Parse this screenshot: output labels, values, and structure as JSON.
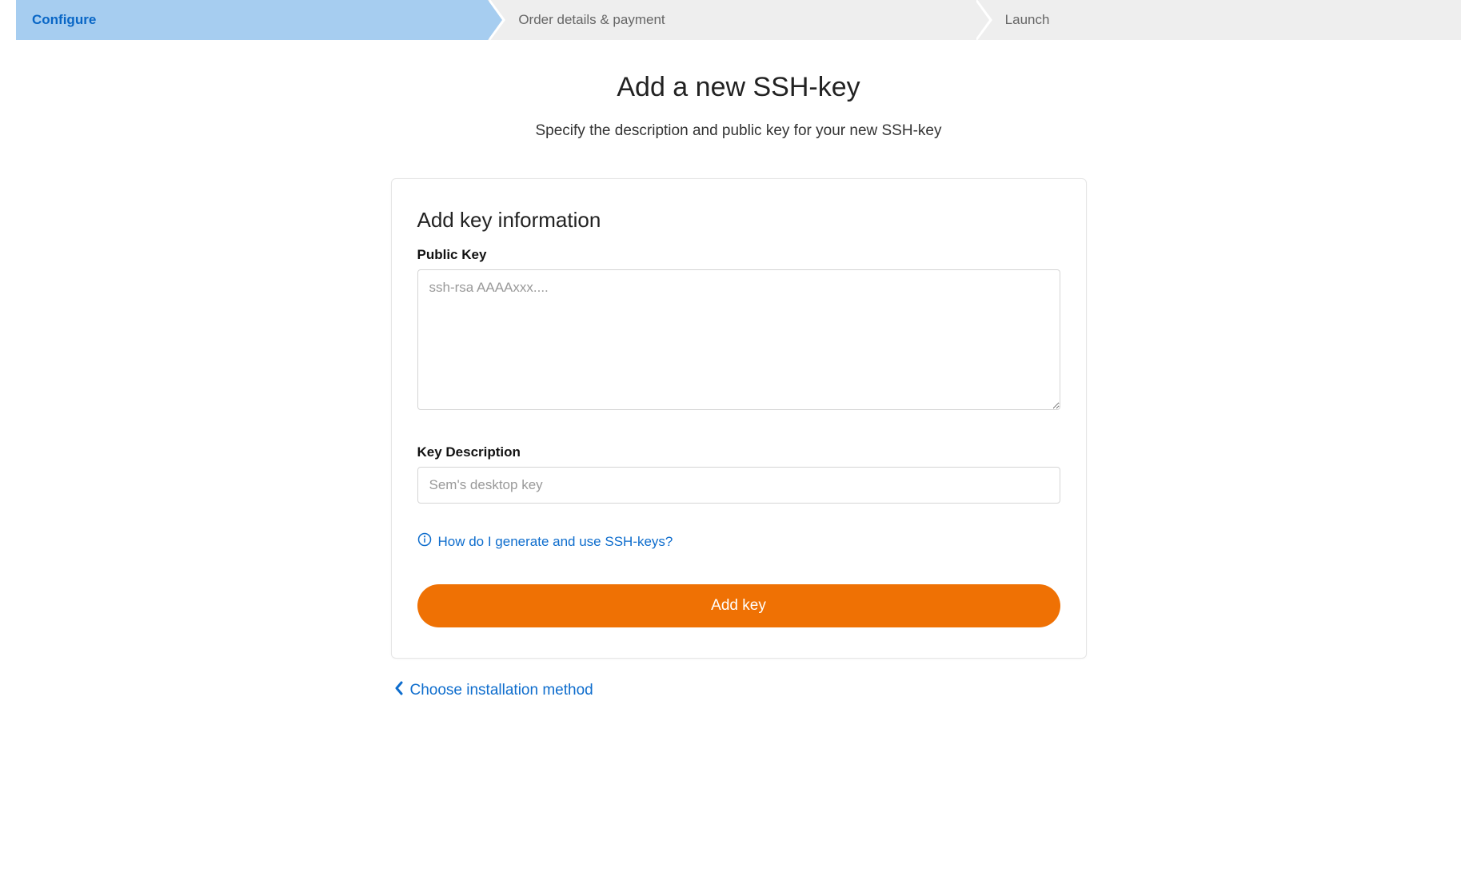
{
  "progress": {
    "steps": [
      {
        "label": "Configure",
        "active": true
      },
      {
        "label": "Order details & payment",
        "active": false
      },
      {
        "label": "Launch",
        "active": false
      }
    ]
  },
  "header": {
    "title": "Add a new SSH-key",
    "subtitle": "Specify the description and public key for your new SSH-key"
  },
  "form": {
    "section_title": "Add key information",
    "public_key": {
      "label": "Public Key",
      "placeholder": "ssh-rsa AAAAxxx....",
      "value": ""
    },
    "key_description": {
      "label": "Key Description",
      "placeholder": "Sem's desktop key",
      "value": ""
    },
    "help_link": "How do I generate and use SSH-keys?",
    "submit_label": "Add key"
  },
  "back_link": "Choose installation method"
}
